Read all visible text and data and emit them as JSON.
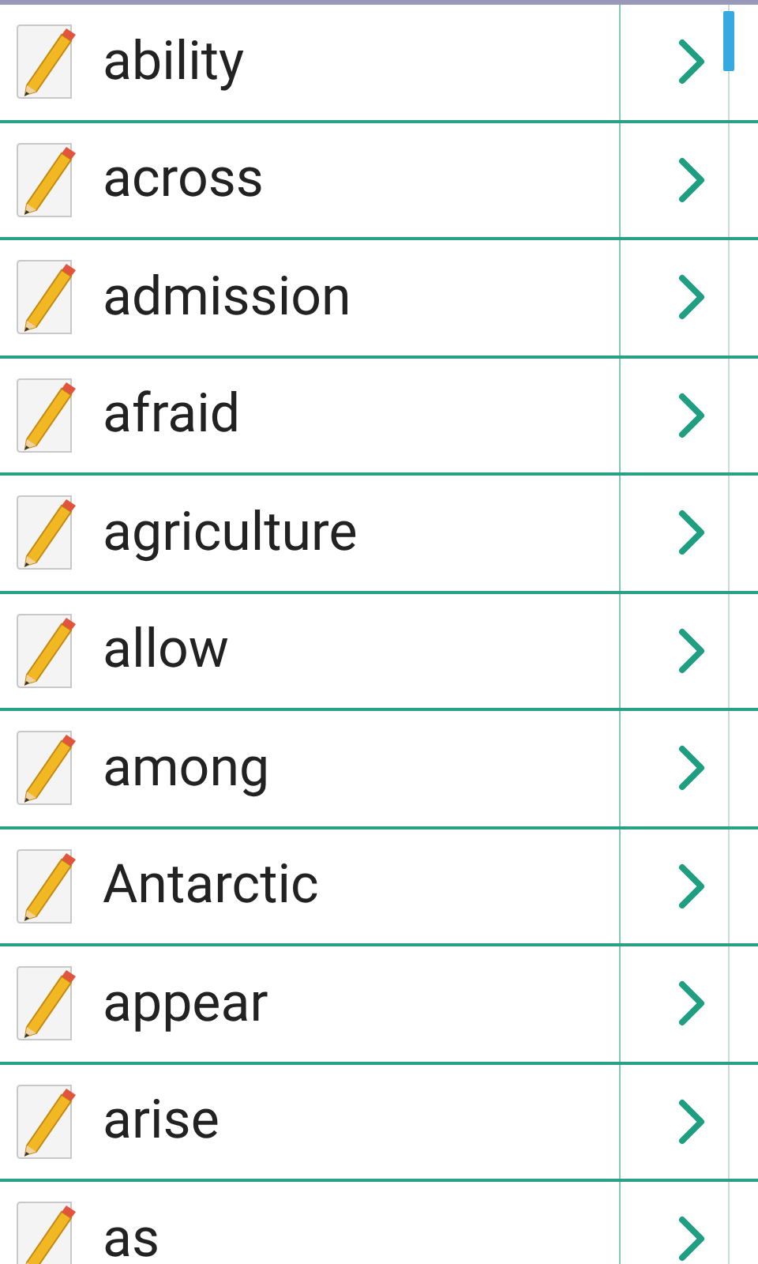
{
  "words": [
    {
      "word": "ability"
    },
    {
      "word": "across"
    },
    {
      "word": "admission"
    },
    {
      "word": "afraid"
    },
    {
      "word": "agriculture"
    },
    {
      "word": "allow"
    },
    {
      "word": "among"
    },
    {
      "word": "Antarctic"
    },
    {
      "word": "appear"
    },
    {
      "word": "arise"
    },
    {
      "word": "as"
    }
  ]
}
